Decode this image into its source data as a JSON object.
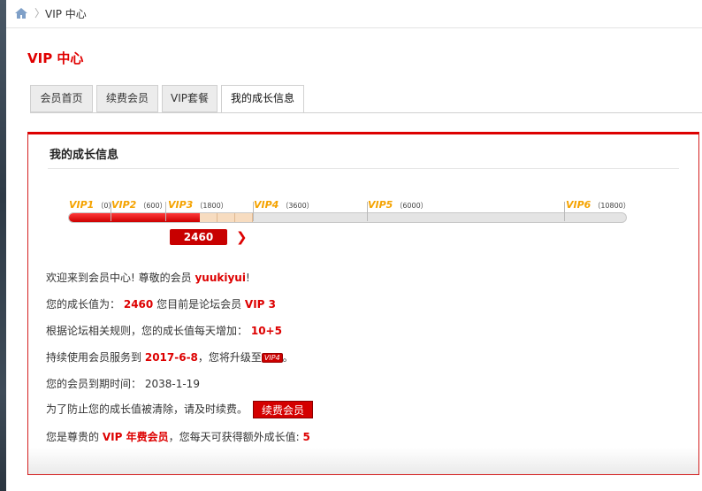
{
  "breadcrumb": {
    "current": "VIP 中心"
  },
  "page_title": "VIP 中心",
  "tabs": [
    {
      "label": "会员首页",
      "active": false
    },
    {
      "label": "续费会员",
      "active": false
    },
    {
      "label": "VIP套餐",
      "active": false
    },
    {
      "label": "我的成长信息",
      "active": true
    }
  ],
  "panel": {
    "title": "我的成长信息",
    "levels": [
      {
        "name": "VIP1",
        "value": "（0）"
      },
      {
        "name": "VIP2",
        "value": "（600）"
      },
      {
        "name": "VIP3",
        "value": "（1800）"
      },
      {
        "name": "VIP4",
        "value": "（3600）"
      },
      {
        "name": "VIP5",
        "value": "（6000）"
      },
      {
        "name": "VIP6",
        "value": "（10800）"
      }
    ],
    "progress_value": "2460",
    "welcome_prefix": "欢迎来到会员中心! 尊敬的会员",
    "username": "yuukiyui",
    "welcome_suffix": "!",
    "growth_prefix": "您的成长值为：",
    "growth_value": "2460",
    "growth_mid": "您目前是论坛会员",
    "current_level": "VIP 3",
    "daily_prefix": "根据论坛相关规则，您的成长值每天增加：",
    "daily_value": "10+5",
    "upgrade_prefix": "持续使用会员服务到",
    "upgrade_date": "2017-6-8",
    "upgrade_mid": "，您将升级至",
    "upgrade_badge": "VIP4",
    "upgrade_suffix": "。",
    "expire_label": "您的会员到期时间：",
    "expire_date": "2038-1-19",
    "reminder": "为了防止您的成长值被清除，请及时续费。",
    "renew_button": "续费会员",
    "annual_prefix": "您是尊贵的",
    "annual_type": "VIP 年费会员",
    "annual_mid": "，您每天可获得额外成长值:",
    "annual_value": "5"
  },
  "colors": {
    "accent": "#d00000",
    "level_label": "#f5a300"
  }
}
